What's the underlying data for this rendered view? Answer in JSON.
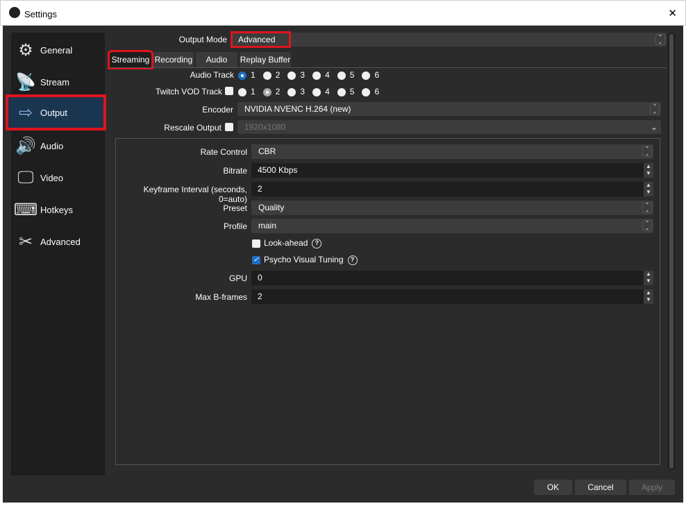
{
  "window": {
    "title": "Settings",
    "close": "✕"
  },
  "sidebar": {
    "items": [
      {
        "label": "General",
        "icon": "⚙"
      },
      {
        "label": "Stream",
        "icon": "📡"
      },
      {
        "label": "Output",
        "icon": "⇨"
      },
      {
        "label": "Audio",
        "icon": "🔊"
      },
      {
        "label": "Video",
        "icon": "🖵"
      },
      {
        "label": "Hotkeys",
        "icon": "⌨"
      },
      {
        "label": "Advanced",
        "icon": "✂"
      }
    ]
  },
  "output_mode": {
    "label": "Output Mode",
    "value": "Advanced"
  },
  "tabs": [
    "Streaming",
    "Recording",
    "Audio",
    "Replay Buffer"
  ],
  "audio_track": {
    "label": "Audio Track",
    "options": [
      "1",
      "2",
      "3",
      "4",
      "5",
      "6"
    ],
    "selected": "1"
  },
  "twitch_vod": {
    "label": "Twitch VOD Track",
    "options": [
      "1",
      "2",
      "3",
      "4",
      "5",
      "6"
    ],
    "selected": "2",
    "checked": false
  },
  "encoder": {
    "label": "Encoder",
    "value": "NVIDIA NVENC H.264 (new)"
  },
  "rescale": {
    "label": "Rescale Output",
    "value": "1920x1080",
    "checked": false
  },
  "settings": {
    "rate_control": {
      "label": "Rate Control",
      "value": "CBR"
    },
    "bitrate": {
      "label": "Bitrate",
      "value": "4500 Kbps"
    },
    "keyframe": {
      "label": "Keyframe Interval (seconds, 0=auto)",
      "value": "2"
    },
    "preset": {
      "label": "Preset",
      "value": "Quality"
    },
    "profile": {
      "label": "Profile",
      "value": "main"
    },
    "lookahead": {
      "label": "Look-ahead",
      "checked": false
    },
    "psycho": {
      "label": "Psycho Visual Tuning",
      "checked": true
    },
    "gpu": {
      "label": "GPU",
      "value": "0"
    },
    "bframes": {
      "label": "Max B-frames",
      "value": "2"
    }
  },
  "buttons": {
    "ok": "OK",
    "cancel": "Cancel",
    "apply": "Apply"
  }
}
